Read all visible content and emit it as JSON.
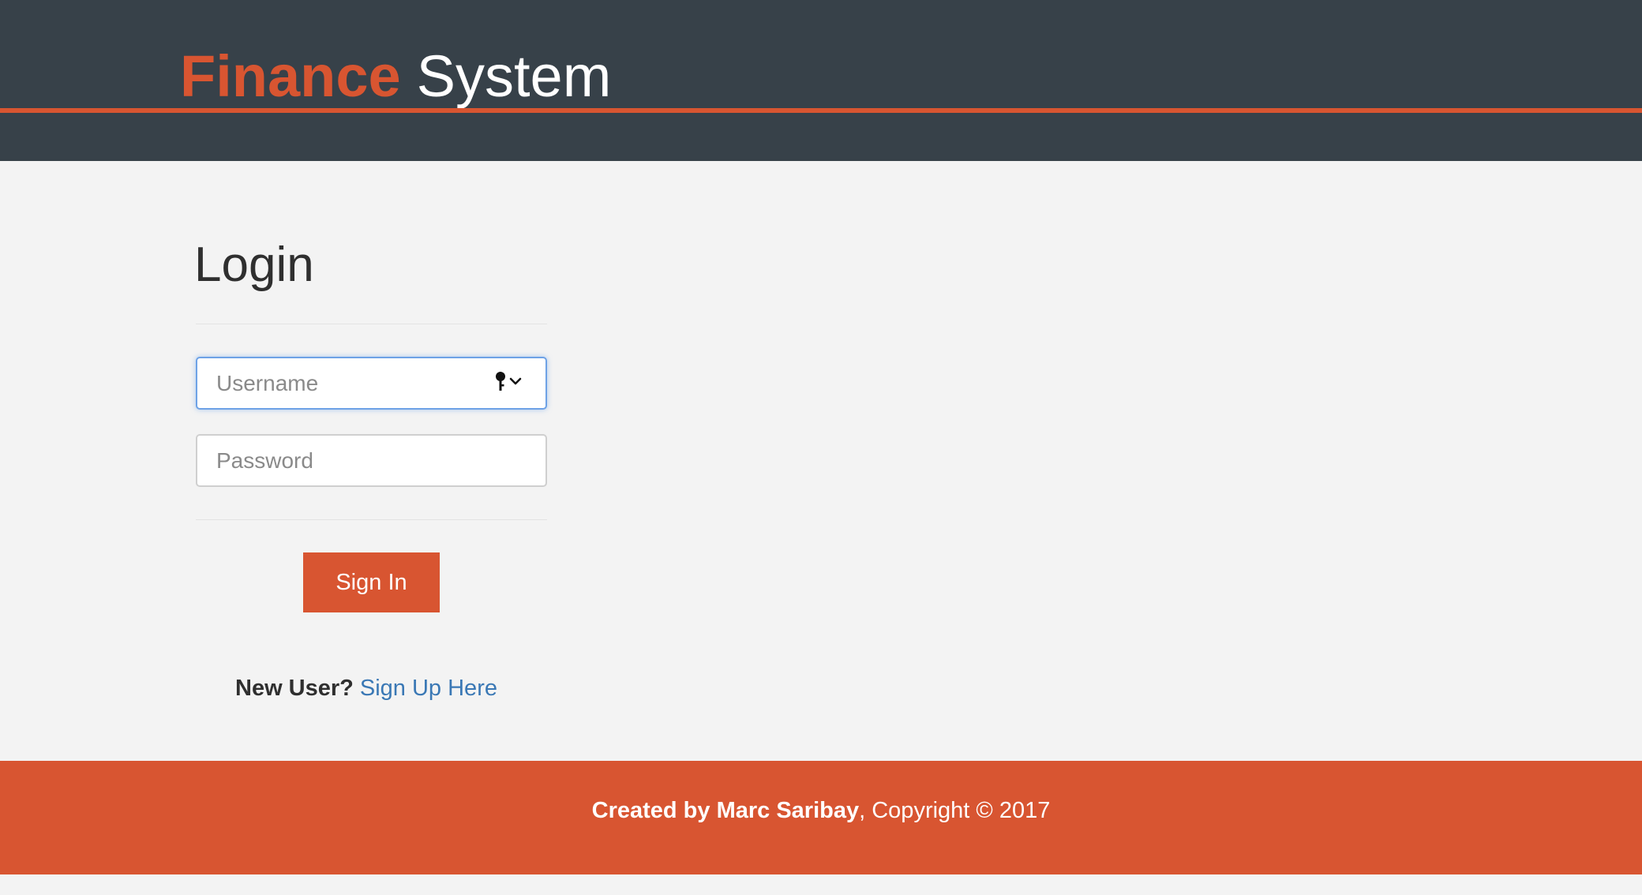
{
  "header": {
    "brand_accent": "Finance",
    "brand_rest": "System"
  },
  "login": {
    "title": "Login",
    "username_placeholder": "Username",
    "password_placeholder": "Password",
    "submit_label": "Sign In",
    "key_icon": "key-icon",
    "dropdown_icon": "chevron-down-icon"
  },
  "signup": {
    "prompt": "New User?",
    "link_label": "Sign Up Here"
  },
  "footer": {
    "credit": "Created by Marc Saribay",
    "copyright": ", Copyright © 2017"
  },
  "colors": {
    "header_bg": "#374149",
    "accent": "#d85531",
    "page_bg": "#f3f3f3",
    "link": "#3a78b5",
    "focus_border": "#6ea2e6"
  }
}
